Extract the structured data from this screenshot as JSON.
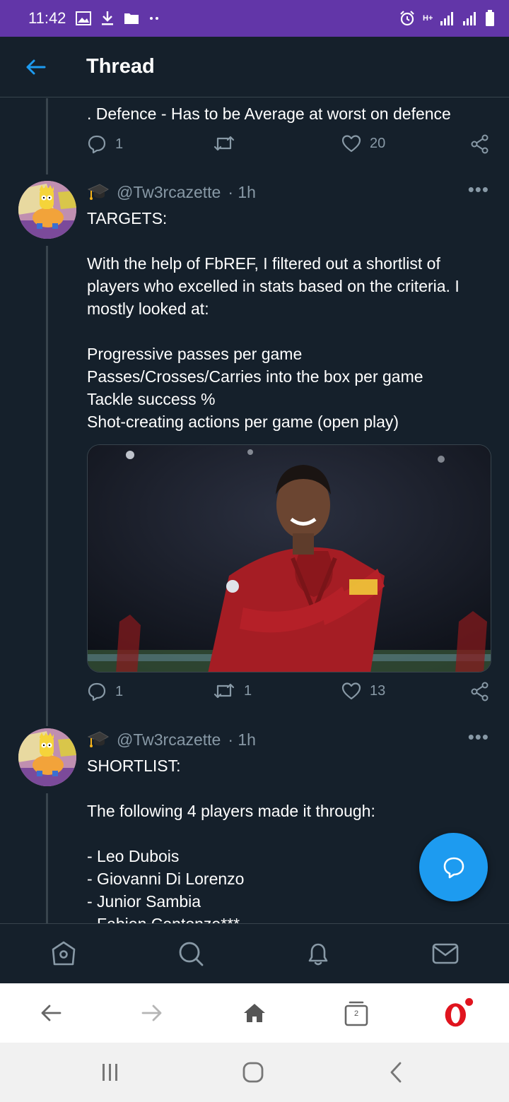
{
  "status_bar": {
    "time": "11:42",
    "network_label": "H+"
  },
  "header": {
    "title": "Thread"
  },
  "tweets": [
    {
      "text": ". Defence - Has to be Average at worst on defence",
      "reply_count": "1",
      "retweet_count": "",
      "like_count": "20"
    },
    {
      "handle": "@Tw3rcazette",
      "time": "· 1h",
      "text": "TARGETS:\n\nWith the help of FbREF, I filtered out a shortlist of players who excelled in stats based on the criteria. I mostly looked at:\n\nProgressive passes per game\nPasses/Crosses/Carries into the box per game\nTackle success %\nShot-creating actions per game (open play)",
      "reply_count": "1",
      "retweet_count": "1",
      "like_count": "13"
    },
    {
      "handle": "@Tw3rcazette",
      "time": "· 1h",
      "text": "SHORTLIST:\n\nThe following 4 players made it through:\n\n- Leo Dubois\n- Giovanni Di Lorenzo\n- Junior Sambia\n- Fabien Centonze***"
    }
  ],
  "browser": {
    "tab_count": "2"
  },
  "colors": {
    "status_bar": "#6236a8",
    "background": "#15202b",
    "accent": "#1d9bf0",
    "secondary_text": "#8899a6",
    "divider": "#38444d",
    "opera_red": "#e0141e"
  },
  "icons": {
    "back": "arrow-left-icon",
    "reply": "reply-icon",
    "retweet": "retweet-icon",
    "like": "heart-icon",
    "share": "share-icon",
    "badge": "graduation-cap-icon",
    "compose": "compose-reply-icon",
    "home": "home-icon",
    "search": "search-icon",
    "notifications": "bell-icon",
    "messages": "mail-icon"
  }
}
